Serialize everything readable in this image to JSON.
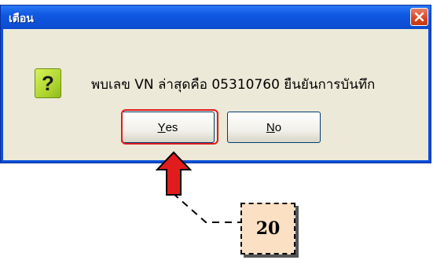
{
  "dialog": {
    "title": "เตือน",
    "message": "พบเลข VN ล่าสุดคือ 05310760 ยืนยันการบันทึก",
    "buttons": {
      "yes_mnemonic": "Y",
      "yes_rest": "es",
      "no_mnemonic": "N",
      "no_rest": "o"
    },
    "icon": "question-icon",
    "close_icon": "close-icon"
  },
  "annotation": {
    "step_number": "20",
    "arrow_color": "#e11c1c",
    "box_color": "#fbe0c4"
  },
  "colors": {
    "titlebar": "#0f58e2",
    "client": "#ece9d8",
    "close": "#d9441f",
    "icon_green": "#a9d12a"
  }
}
